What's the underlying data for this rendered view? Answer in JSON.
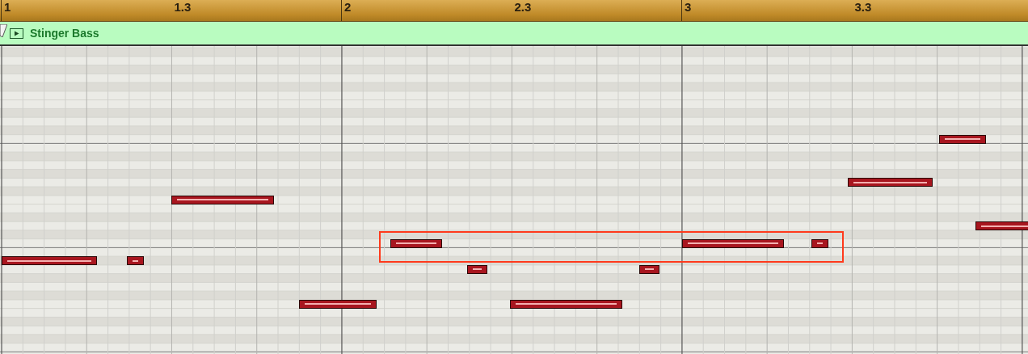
{
  "ruler": {
    "markers": [
      {
        "label": "1"
      },
      {
        "label": "1.3"
      },
      {
        "label": "2"
      },
      {
        "label": "2.3"
      },
      {
        "label": "3"
      },
      {
        "label": "3.3"
      }
    ]
  },
  "region": {
    "name": "Stinger Bass"
  }
}
